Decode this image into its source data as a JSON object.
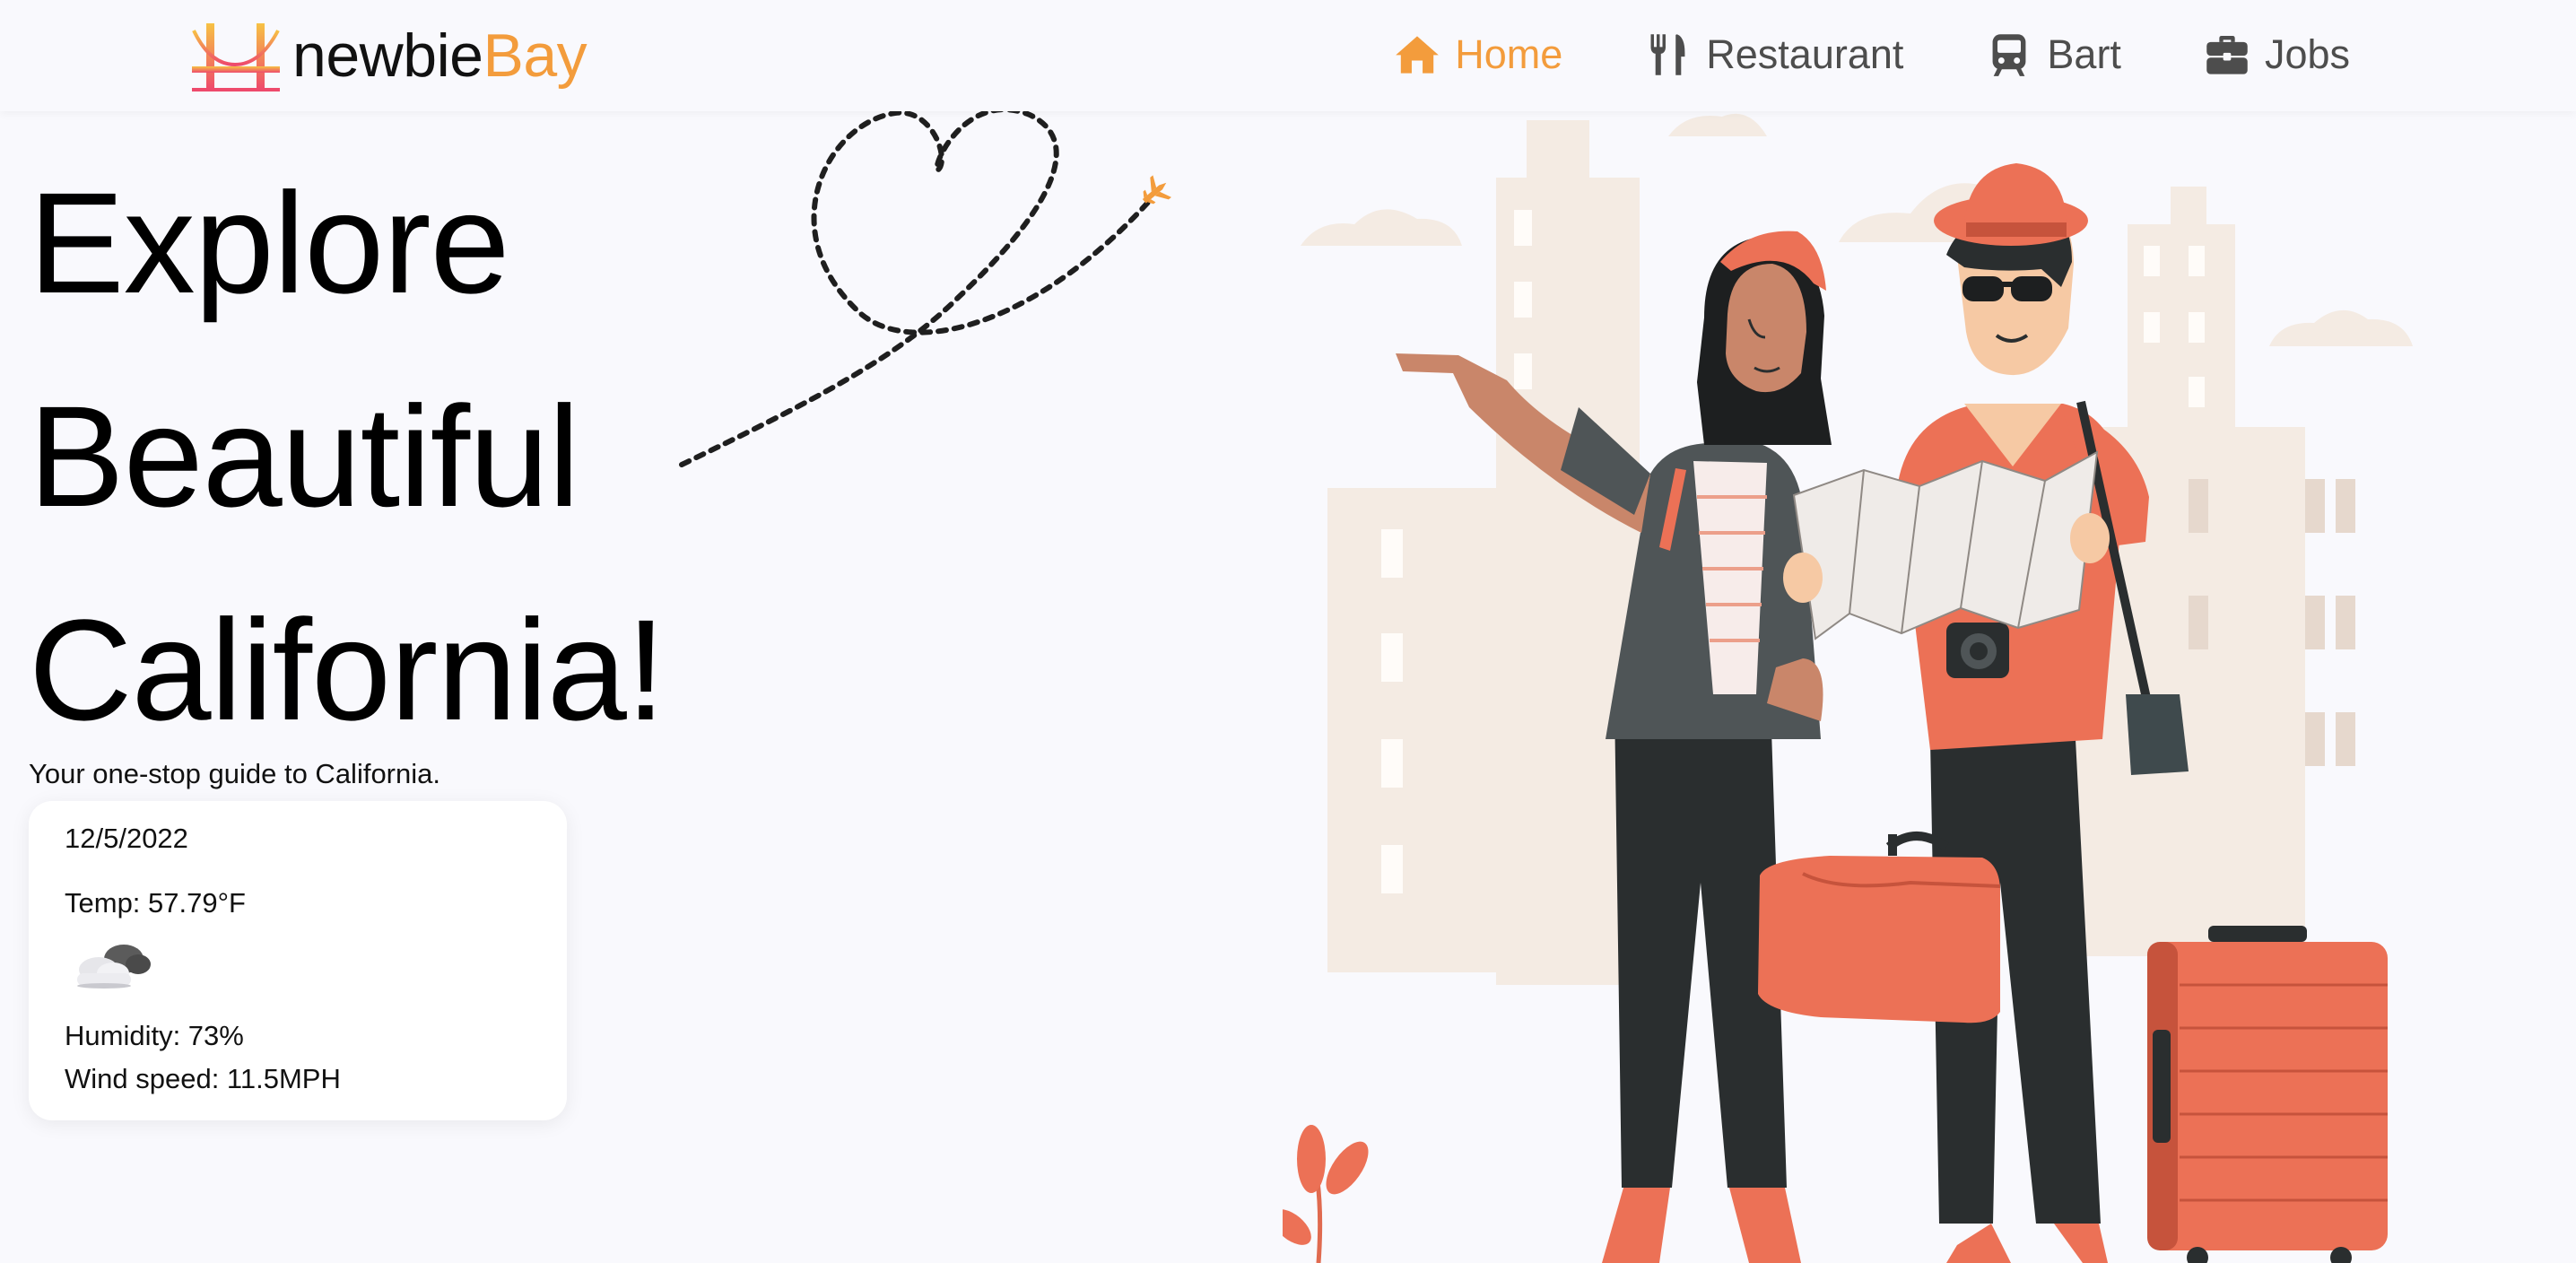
{
  "brand": {
    "name_part1": "newbie",
    "name_part2": "Bay",
    "logo_icon": "golden-gate-bridge-icon",
    "accent_color": "#f39c3c"
  },
  "nav": {
    "items": [
      {
        "label": "Home",
        "icon": "home-icon",
        "active": true
      },
      {
        "label": "Restaurant",
        "icon": "utensils-icon",
        "active": false
      },
      {
        "label": "Bart",
        "icon": "train-icon",
        "active": false
      },
      {
        "label": "Jobs",
        "icon": "briefcase-icon",
        "active": false
      }
    ]
  },
  "hero": {
    "title_lines": [
      "Explore",
      "Beautiful",
      "California!"
    ],
    "tagline": "Your one-stop guide to California."
  },
  "weather": {
    "date": "12/5/2022",
    "temp": "Temp: 57.79°F",
    "icon": "cloudy-icon",
    "humidity": "Humidity: 73%",
    "wind": "Wind speed: 11.5MPH"
  },
  "colors": {
    "background": "#f9f9fd",
    "accent": "#f39c3c",
    "nav_text": "#4d4d4d",
    "illustration_coral": "#ec7156",
    "illustration_dark": "#2a2e2f"
  }
}
